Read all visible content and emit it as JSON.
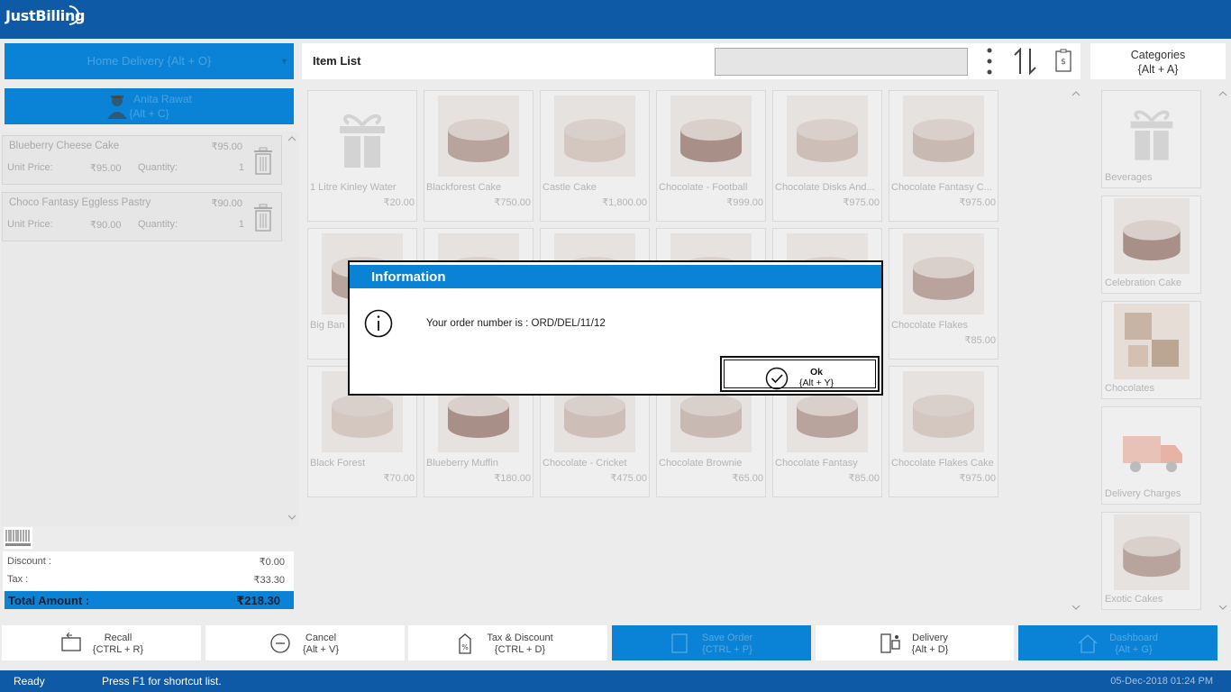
{
  "app": {
    "title": "JustBilling"
  },
  "order_type": {
    "label": "Home Delivery {Alt + O}"
  },
  "customer": {
    "name": "Anita Rawat",
    "shortcut": "{Alt + C}"
  },
  "cart": {
    "items": [
      {
        "name": "Blueberry Cheese Cake",
        "price": "₹95.00",
        "unit_price_label": "Unit Price:",
        "unit_price": "₹95.00",
        "quantity_label": "Quantity:",
        "quantity": "1"
      },
      {
        "name": "Choco Fantasy Eggless Pastry",
        "price": "₹90.00",
        "unit_price_label": "Unit Price:",
        "unit_price": "₹90.00",
        "quantity_label": "Quantity:",
        "quantity": "1"
      }
    ],
    "discount_label": "Discount :",
    "discount": "₹0.00",
    "tax_label": "Tax :",
    "tax": "₹33.30",
    "total_label": "Total Amount :",
    "total": "₹218.30"
  },
  "item_list": {
    "title": "Item List",
    "search_value": ""
  },
  "categories_header": {
    "title": "Categories",
    "shortcut": "{Alt + A}"
  },
  "items": [
    {
      "name": "1 Litre Kinley Water",
      "price": "₹20.00",
      "icon": "gift-icon"
    },
    {
      "name": "Blackforest Cake",
      "price": "₹750.00",
      "icon": "cake-image"
    },
    {
      "name": "Castle Cake",
      "price": "₹1,800.00",
      "icon": "cake-image"
    },
    {
      "name": "Chocolate - Football",
      "price": "₹999.00",
      "icon": "cake-image"
    },
    {
      "name": "Chocolate Disks And...",
      "price": "₹975.00",
      "icon": "cake-image"
    },
    {
      "name": "Chocolate Fantasy C...",
      "price": "₹975.00",
      "icon": "cake-image"
    },
    {
      "name": "Big Ban",
      "price": "",
      "icon": "cake-image"
    },
    {
      "name": "",
      "price": "",
      "icon": "cake-image"
    },
    {
      "name": "",
      "price": "",
      "icon": "cake-image"
    },
    {
      "name": "",
      "price": "",
      "icon": "cake-image"
    },
    {
      "name": "",
      "price": "",
      "icon": "cake-image"
    },
    {
      "name": "Chocolate Flakes",
      "price": "₹85.00",
      "icon": "cake-image"
    },
    {
      "name": "Black Forest",
      "price": "₹70.00",
      "icon": "cake-image"
    },
    {
      "name": "Blueberry Muffin",
      "price": "₹180.00",
      "icon": "cake-image"
    },
    {
      "name": "Chocolate - Cricket",
      "price": "₹475.00",
      "icon": "cake-image"
    },
    {
      "name": "Chocolate Brownie",
      "price": "₹65.00",
      "icon": "cake-image"
    },
    {
      "name": "Chocolate Fantasy",
      "price": "₹85.00",
      "icon": "cake-image"
    },
    {
      "name": "Chocolate Flakes Cake",
      "price": "₹975.00",
      "icon": "cake-image"
    }
  ],
  "categories": [
    {
      "name": "Beverages",
      "icon": "gift-icon"
    },
    {
      "name": "Celebration Cake",
      "icon": "cake-image"
    },
    {
      "name": "Chocolates",
      "icon": "chocolate-image"
    },
    {
      "name": "Delivery Charges",
      "icon": "truck-icon"
    },
    {
      "name": "Exotic Cakes",
      "icon": "cake-image"
    }
  ],
  "bottom_buttons": {
    "recall": {
      "label": "Recall",
      "shortcut": "{CTRL + R}"
    },
    "cancel": {
      "label": "Cancel",
      "shortcut": "{Alt + V}"
    },
    "tax_discount": {
      "label": "Tax & Discount",
      "shortcut": "{CTRL + D}"
    },
    "save_order": {
      "label": "Save Order",
      "shortcut": "{CTRL + P}"
    },
    "delivery": {
      "label": "Delivery",
      "shortcut": "{Alt + D}"
    },
    "dashboard": {
      "label": "Dashboard",
      "shortcut": "{Alt + G}"
    }
  },
  "status": {
    "state": "Ready",
    "hint": "Press F1 for shortcut list.",
    "datetime": "05-Dec-2018 01:24 PM"
  },
  "dialog": {
    "title": "Information",
    "message": "Your order number is : ORD/DEL/11/12",
    "ok_label": "Ok",
    "ok_shortcut": "{Alt + Y}"
  },
  "colors": {
    "primary": "#0a83d6",
    "titlebar": "#0f5aa6"
  }
}
